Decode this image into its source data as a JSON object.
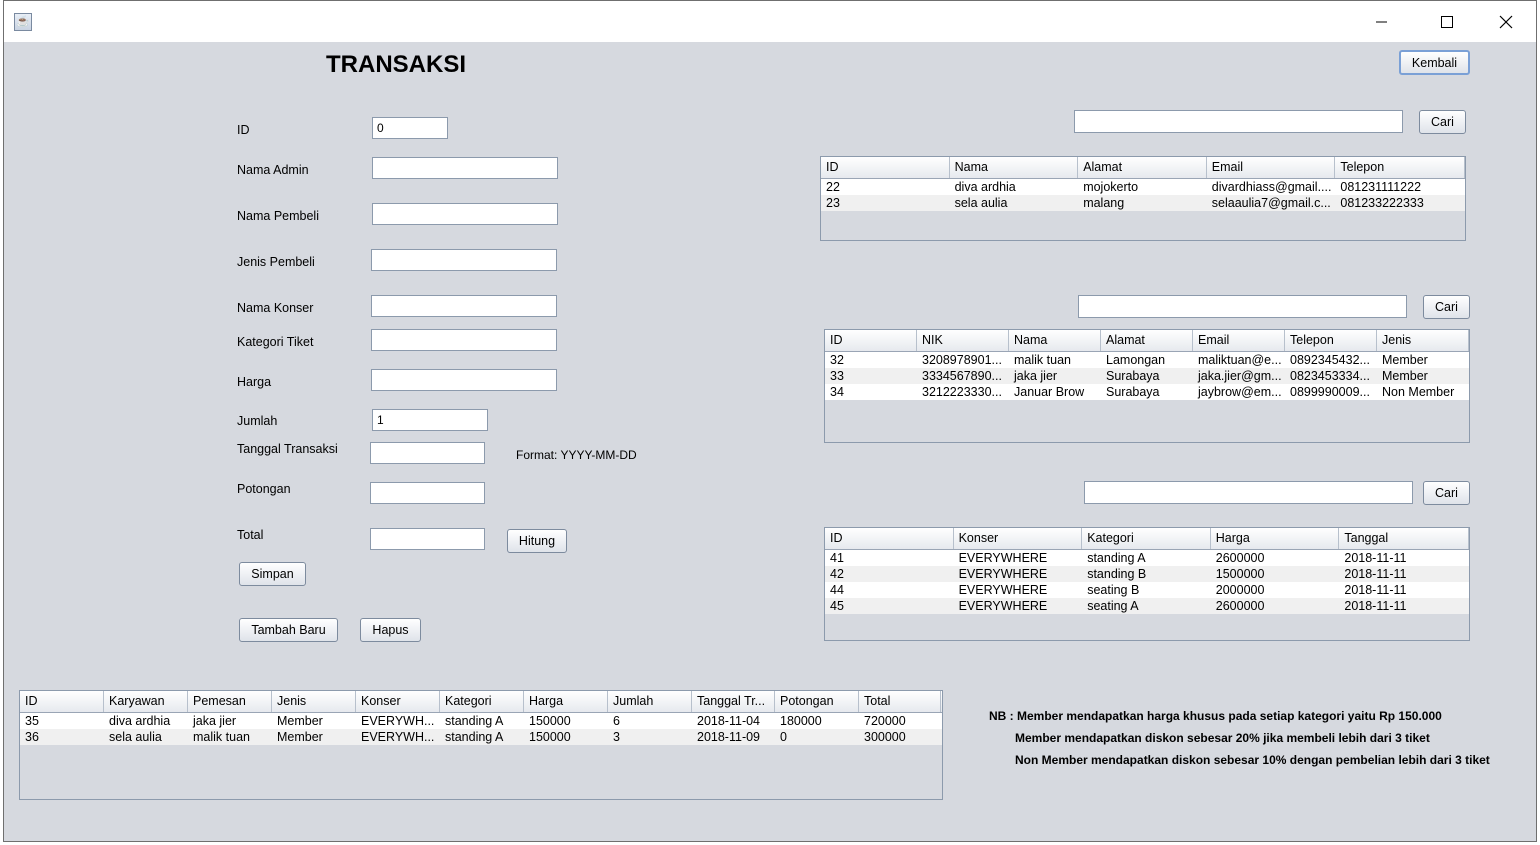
{
  "window": {
    "icon": "java-cup-icon",
    "controls": [
      "minimize-icon",
      "maximize-icon",
      "close-icon"
    ]
  },
  "form": {
    "title": "TRANSAKSI",
    "kembali": "Kembali",
    "fields": {
      "id": {
        "label": "ID",
        "value": "0"
      },
      "nama_admin": {
        "label": "Nama Admin",
        "value": ""
      },
      "nama_pembeli": {
        "label": "Nama Pembeli",
        "value": ""
      },
      "jenis_pembeli": {
        "label": "Jenis Pembeli",
        "value": ""
      },
      "nama_konser": {
        "label": "Nama Konser",
        "value": ""
      },
      "kategori_tiket": {
        "label": "Kategori Tiket",
        "value": ""
      },
      "harga": {
        "label": "Harga",
        "value": ""
      },
      "jumlah": {
        "label": "Jumlah",
        "value": "1"
      },
      "tanggal_transaksi": {
        "label": "Tanggal Transaksi",
        "value": ""
      },
      "potongan": {
        "label": "Potongan",
        "value": ""
      },
      "total": {
        "label": "Total",
        "value": ""
      }
    },
    "format_hint": "Format: YYYY-MM-DD",
    "hitung": "Hitung",
    "simpan": "Simpan",
    "tambah_baru": "Tambah Baru",
    "hapus": "Hapus"
  },
  "admin_search": {
    "value": "",
    "button": "Cari"
  },
  "admin_table": {
    "columns": [
      "ID",
      "Nama",
      "Alamat",
      "Email",
      "Telepon"
    ],
    "rows": [
      [
        "22",
        "diva ardhia",
        "mojokerto",
        "divardhiass@gmail....",
        "081231111222"
      ],
      [
        "23",
        "sela aulia",
        "malang",
        "selaaulia7@gmail.c...",
        "081233222333"
      ]
    ]
  },
  "pembeli_search": {
    "value": "",
    "button": "Cari"
  },
  "pembeli_table": {
    "columns": [
      "ID",
      "NIK",
      "Nama",
      "Alamat",
      "Email",
      "Telepon",
      "Jenis"
    ],
    "rows": [
      [
        "32",
        "3208978901...",
        "malik tuan",
        "Lamongan",
        "maliktuan@e...",
        "0892345432...",
        "Member"
      ],
      [
        "33",
        "3334567890...",
        "jaka jier",
        "Surabaya",
        "jaka.jier@gm...",
        "0823453334...",
        "Member"
      ],
      [
        "34",
        "3212223330...",
        "Januar Brow",
        "Surabaya",
        "jaybrow@em...",
        "0899990009...",
        "Non Member"
      ]
    ]
  },
  "tiket_search": {
    "value": "",
    "button": "Cari"
  },
  "tiket_table": {
    "columns": [
      "ID",
      "Konser",
      "Kategori",
      "Harga",
      "Tanggal"
    ],
    "rows": [
      [
        "41",
        "EVERYWHERE",
        "standing A",
        "2600000",
        "2018-11-11"
      ],
      [
        "42",
        "EVERYWHERE",
        "standing B",
        "1500000",
        "2018-11-11"
      ],
      [
        "44",
        "EVERYWHERE",
        "seating B",
        "2000000",
        "2018-11-11"
      ],
      [
        "45",
        "EVERYWHERE",
        "seating A",
        "2600000",
        "2018-11-11"
      ]
    ]
  },
  "transaksi_table": {
    "columns": [
      "ID",
      "Karyawan",
      "Pemesan",
      "Jenis",
      "Konser",
      "Kategori",
      "Harga",
      "Jumlah",
      "Tanggal Tr...",
      "Potongan",
      "Total"
    ],
    "rows": [
      [
        "35",
        "diva ardhia",
        "jaka jier",
        "Member",
        "EVERYWH...",
        "standing A",
        "150000",
        "6",
        "2018-11-04",
        "180000",
        "720000"
      ],
      [
        "36",
        "sela aulia",
        "malik tuan",
        "Member",
        "EVERYWH...",
        "standing A",
        "150000",
        "3",
        "2018-11-09",
        "0",
        "300000"
      ]
    ]
  },
  "notes": {
    "line1": "NB : Member mendapatkan harga khusus pada setiap kategori yaitu Rp 150.000",
    "line2": "Member mendapatkan diskon sebesar 20% jika membeli lebih dari 3 tiket",
    "line3": "Non Member mendapatkan diskon sebesar 10% dengan pembelian lebih dari 3 tiket"
  }
}
